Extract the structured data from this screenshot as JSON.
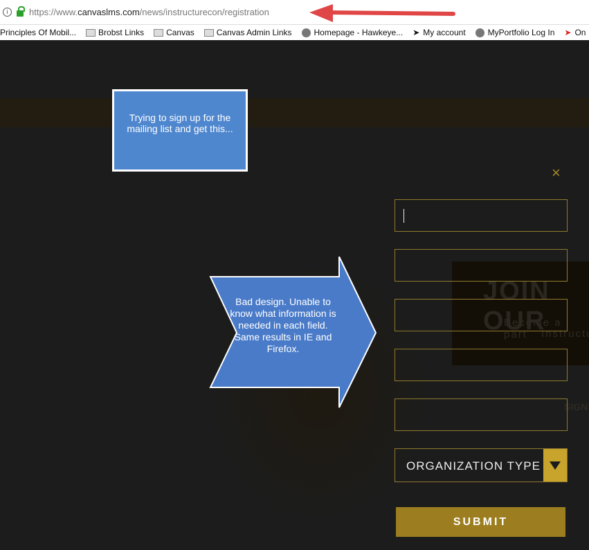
{
  "browser": {
    "url_prefix": "https://www.",
    "url_domain": "canvaslms.com",
    "url_path": "/news/instructurecon/registration",
    "bookmarks": [
      {
        "label": "Principles Of Mobil...",
        "icon": "none"
      },
      {
        "label": "Brobst Links",
        "icon": "folder-icon"
      },
      {
        "label": "Canvas",
        "icon": "folder-icon"
      },
      {
        "label": "Canvas Admin Links",
        "icon": "folder-icon"
      },
      {
        "label": "Homepage - Hawkeye...",
        "icon": "globe-icon"
      },
      {
        "label": "My account",
        "icon": "bookmark-icon"
      },
      {
        "label": "MyPortfolio Log In",
        "icon": "globe-icon"
      },
      {
        "label": "On",
        "icon": "bookmark-icon"
      }
    ]
  },
  "background": {
    "heading": "JOIN OUR",
    "line1": "Become a part",
    "line2": "Instructu",
    "sign": "SIGN"
  },
  "form": {
    "organization_type": "ORGANIZATION TYPE",
    "submit": "SUBMIT",
    "close": "×"
  },
  "annotations": {
    "callout": "Trying to sign up for the mailing list and get this...",
    "arrow": "Bad design. Unable to know what information is needed in each field. Same results in IE and Firefox."
  },
  "colors": {
    "accent": "#c9a42c",
    "submit": "#9c7e20",
    "annotation": "#4f87cf",
    "red_arrow": "#e04646"
  }
}
